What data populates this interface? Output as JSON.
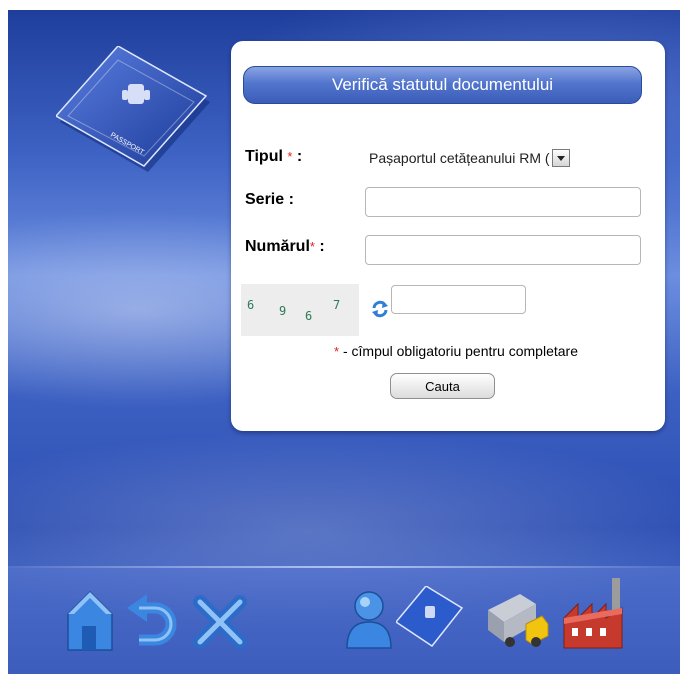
{
  "panel": {
    "title": "Verifică statutul documentului"
  },
  "form": {
    "type_label": "Tipul",
    "type_required": "*",
    "type_colon": " :",
    "type_value": "Pașaportul cetățeanului RM (",
    "series_label": "Serie :",
    "number_label": "Numărul",
    "number_required": "*",
    "number_colon": " :",
    "series_value": "",
    "number_value": "",
    "captcha_value": ""
  },
  "captcha": {
    "digits": [
      "6",
      "9",
      "6",
      "7"
    ]
  },
  "note": {
    "star": "*",
    "text": " - cîmpul obligatoriu pentru completare"
  },
  "button": {
    "search_label": "Cauta"
  },
  "passport_badge": "PASSPORT",
  "dock": {
    "icons": [
      "home-icon",
      "back-icon",
      "close-icon",
      "user-icon",
      "passport-icon",
      "truck-icon",
      "factory-icon"
    ]
  },
  "colors": {
    "accent": "#3b5db8",
    "required": "#e02020",
    "captcha": "#2b7b56"
  }
}
